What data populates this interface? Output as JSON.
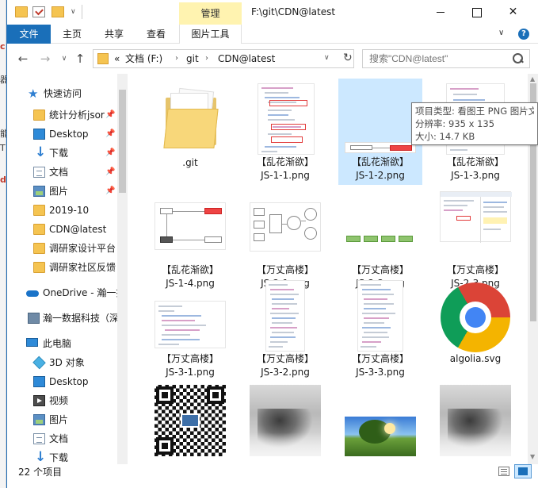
{
  "titlebar": {
    "manage_tab": "管理",
    "path_title": "F:\\git\\CDN@latest",
    "minimize_icon": "minimize-icon",
    "maximize_icon": "maximize-icon",
    "close_glyph": "✕"
  },
  "ribbon": {
    "tabs": [
      "文件",
      "主页",
      "共享",
      "查看",
      "图片工具"
    ],
    "expand_glyph": "∨",
    "help_glyph": "?"
  },
  "nav": {
    "back": "←",
    "forward": "→",
    "recent": "∨",
    "up": "↑",
    "breadcrumb_prefix": "«",
    "crumbs": [
      "文档 (F:)",
      "git",
      "CDN@latest"
    ],
    "crumb_sep": "›",
    "dropdown": "∨",
    "refresh": "↻",
    "search_placeholder": "搜索\"CDN@latest\""
  },
  "sidebar": {
    "items": [
      {
        "label": "快速访问",
        "icon": "star-icon",
        "pinned": false
      },
      {
        "label": "统计分析jsor",
        "icon": "folder-icon",
        "pinned": true
      },
      {
        "label": "Desktop",
        "icon": "desktop-icon",
        "pinned": true
      },
      {
        "label": "下载",
        "icon": "download-icon",
        "pinned": true
      },
      {
        "label": "文档",
        "icon": "document-icon",
        "pinned": true
      },
      {
        "label": "图片",
        "icon": "pictures-icon",
        "pinned": true
      },
      {
        "label": "2019-10",
        "icon": "folder-icon",
        "pinned": false
      },
      {
        "label": "CDN@latest",
        "icon": "folder-icon",
        "pinned": false
      },
      {
        "label": "调研家设计平台",
        "icon": "folder-icon",
        "pinned": false
      },
      {
        "label": "调研家社区反馈",
        "icon": "folder-icon",
        "pinned": false
      },
      {
        "label": "OneDrive - 瀚一技",
        "icon": "onedrive-icon",
        "pinned": false
      },
      {
        "label": "瀚一数据科技（深",
        "icon": "building-icon",
        "pinned": false
      },
      {
        "label": "此电脑",
        "icon": "computer-icon",
        "pinned": false
      },
      {
        "label": "3D 对象",
        "icon": "3d-objects-icon",
        "pinned": false
      },
      {
        "label": "Desktop",
        "icon": "desktop-icon",
        "pinned": false
      },
      {
        "label": "视频",
        "icon": "video-icon",
        "pinned": false
      },
      {
        "label": "图片",
        "icon": "pictures-icon",
        "pinned": false
      },
      {
        "label": "文档",
        "icon": "document-icon",
        "pinned": false
      },
      {
        "label": "下载",
        "icon": "download-icon",
        "pinned": false
      }
    ],
    "pin_glyph": "📌"
  },
  "files": [
    {
      "line1": "",
      "line2": ".git",
      "kind": "folder"
    },
    {
      "line1": "【乱花渐欲】",
      "line2": "JS-1-1.png",
      "kind": "code"
    },
    {
      "line1": "【乱花渐欲】",
      "line2": "JS-1-2.png",
      "kind": "diagram-small",
      "selected": true
    },
    {
      "line1": "【乱花渐欲】",
      "line2": "JS-1-3.png",
      "kind": "code"
    },
    {
      "line1": "【乱花渐欲】",
      "line2": "JS-1-4.png",
      "kind": "diagram"
    },
    {
      "line1": "【万丈高楼】",
      "line2": "JS-2-1.png",
      "kind": "diagram-circles"
    },
    {
      "line1": "【万丈高楼】",
      "line2": "JS-2-2.png",
      "kind": "diagram-green"
    },
    {
      "line1": "【万丈高楼】",
      "line2": "JS-2-3.png",
      "kind": "devtools"
    },
    {
      "line1": "【万丈高楼】",
      "line2": "JS-3-1.png",
      "kind": "code"
    },
    {
      "line1": "【万丈高楼】",
      "line2": "JS-3-2.png",
      "kind": "code-long"
    },
    {
      "line1": "【万丈高楼】",
      "line2": "JS-3-3.png",
      "kind": "code-long"
    },
    {
      "line1": "",
      "line2": "algolia.svg",
      "kind": "chrome"
    },
    {
      "line1": "",
      "line2": "",
      "kind": "qr"
    },
    {
      "line1": "",
      "line2": "",
      "kind": "ink"
    },
    {
      "line1": "",
      "line2": "",
      "kind": "landscape"
    },
    {
      "line1": "",
      "line2": "",
      "kind": "ink"
    }
  ],
  "tooltip": {
    "type": "项目类型: 看图王 PNG 图片文",
    "resolution": "分辨率: 935 x 135",
    "size": "大小: 14.7 KB"
  },
  "status": {
    "count": "22 个项目"
  },
  "background_window": {
    "fragments": [
      "c",
      "器",
      "能",
      "T",
      "dl"
    ]
  }
}
